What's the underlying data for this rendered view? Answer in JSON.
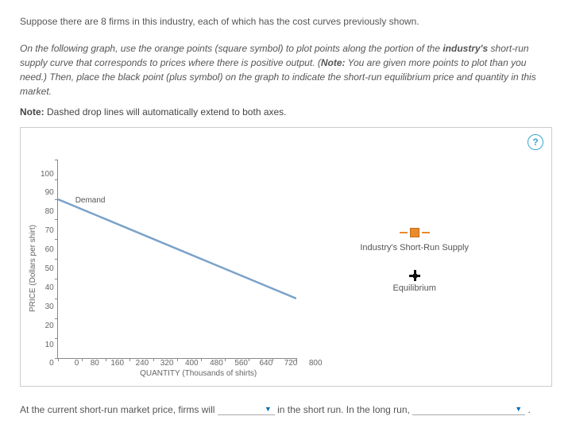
{
  "intro_text": "Suppose there are 8 firms in this industry, each of which has the cost curves previously shown.",
  "instructions_html": "On the following graph, use the orange points (square symbol) to plot points along the portion of the <b>industry's</b> short-run supply curve that corresponds to prices where there is positive output. (<b>Note:</b> You are given more points to plot than you need.) Then, place the black point (plus symbol) on the graph to indicate the short-run equilibrium price and quantity in this market.",
  "note_prefix": "Note:",
  "note_text": " Dashed drop lines will automatically extend to both axes.",
  "chart_data": {
    "type": "line",
    "xlabel": "QUANTITY (Thousands of shirts)",
    "ylabel": "PRICE (Dollars per shirt)",
    "x_ticks": [
      "0",
      "80",
      "160",
      "240",
      "320",
      "400",
      "480",
      "560",
      "640",
      "720",
      "800"
    ],
    "y_ticks": [
      "100",
      "90",
      "80",
      "70",
      "60",
      "50",
      "40",
      "30",
      "20",
      "10",
      "0"
    ],
    "xlim": [
      0,
      800
    ],
    "ylim": [
      0,
      100
    ],
    "series": [
      {
        "name": "Demand",
        "label_position": {
          "x": 60,
          "y": 80
        },
        "x": [
          0,
          800
        ],
        "y": [
          80,
          30
        ],
        "color": "#7aa2c9"
      }
    ]
  },
  "legend": {
    "supply": "Industry's Short-Run Supply",
    "equilibrium": "Equilibrium"
  },
  "help_icon_glyph": "?",
  "question": {
    "part1": "At the current short-run market price, firms will ",
    "part2": " in the short run. In the long run, ",
    "part3": " .",
    "dropdown1_value": "",
    "dropdown2_value": ""
  }
}
